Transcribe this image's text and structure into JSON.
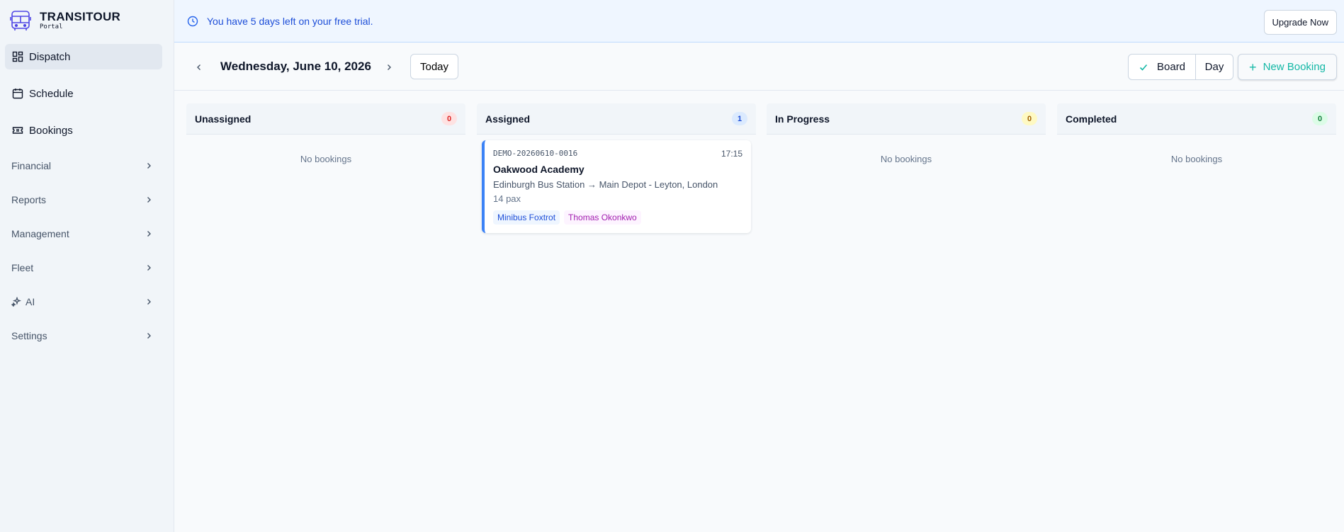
{
  "brand": {
    "title": "TRANSITOUR",
    "subtitle": "Portal"
  },
  "sidebar": {
    "main_items": [
      {
        "label": "Dispatch",
        "icon": "dashboard-icon",
        "active": true
      },
      {
        "label": "Schedule",
        "icon": "calendar-icon"
      },
      {
        "label": "Bookings",
        "icon": "ticket-icon"
      }
    ],
    "groups": [
      {
        "label": "Financial"
      },
      {
        "label": "Reports"
      },
      {
        "label": "Management"
      },
      {
        "label": "Fleet"
      },
      {
        "label": "AI",
        "icon": "sparkles-icon"
      },
      {
        "label": "Settings"
      }
    ]
  },
  "banner": {
    "message": "You have 5 days left on your free trial.",
    "upgrade_label": "Upgrade Now"
  },
  "toolbar": {
    "date": "Wednesday, June 10, 2026",
    "today_label": "Today",
    "board_label": "Board",
    "day_label": "Day",
    "new_booking_label": "New Booking"
  },
  "columns": [
    {
      "title": "Unassigned",
      "count": "0",
      "empty": "No bookings",
      "badge_bg": "#fee2e2",
      "badge_fg": "#dc2626"
    },
    {
      "title": "Assigned",
      "count": "1",
      "badge_bg": "#dbeafe",
      "badge_fg": "#1d4ed8"
    },
    {
      "title": "In Progress",
      "count": "0",
      "empty": "No bookings",
      "badge_bg": "#fef9c3",
      "badge_fg": "#a16207"
    },
    {
      "title": "Completed",
      "count": "0",
      "empty": "No bookings",
      "badge_bg": "#dcfce7",
      "badge_fg": "#15803d"
    }
  ],
  "booking": {
    "ref": "DEMO-20260610-0016",
    "time": "17:15",
    "client": "Oakwood Academy",
    "route": "Edinburgh Bus Station → Main Depot - Leyton, London",
    "pax": "14 pax",
    "vehicle": "Minibus Foxtrot",
    "driver": "Thomas Okonkwo"
  },
  "colors": {
    "accent": "#14b8a6",
    "primary": "#3b82f6",
    "logo": "#4f46e5"
  }
}
